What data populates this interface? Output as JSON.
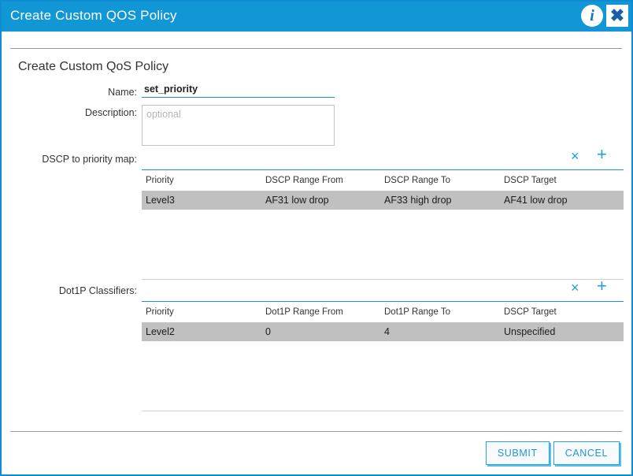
{
  "window": {
    "title": "Create Custom QOS Policy",
    "info_icon": "info-icon",
    "close_icon": "close-icon"
  },
  "form": {
    "heading": "Create Custom QoS Policy",
    "name": {
      "label": "Name:",
      "value": "set_priority",
      "placeholder": ""
    },
    "description": {
      "label": "Description:",
      "value": "",
      "placeholder": "optional"
    }
  },
  "tables": [
    {
      "label": "DSCP to priority map:",
      "remove_icon": "×",
      "add_icon": "+",
      "columns": [
        "Priority",
        "DSCP Range From",
        "DSCP Range To",
        "DSCP Target"
      ],
      "rows": [
        [
          "Level3",
          "AF31 low drop",
          "AF33 high drop",
          "AF41 low drop"
        ]
      ]
    },
    {
      "label": "Dot1P Classifiers:",
      "remove_icon": "×",
      "add_icon": "+",
      "columns": [
        "Priority",
        "Dot1P Range From",
        "Dot1P Range To",
        "DSCP Target"
      ],
      "rows": [
        [
          "Level2",
          "0",
          "4",
          "Unspecified"
        ]
      ]
    }
  ],
  "footer": {
    "submit_label": "SUBMIT",
    "cancel_label": "CANCEL"
  },
  "colors": {
    "titlebar": "#1197d6",
    "accent": "#1e9ce0",
    "row_highlight": "#c0c0c0",
    "border": "#0f8bd3"
  }
}
